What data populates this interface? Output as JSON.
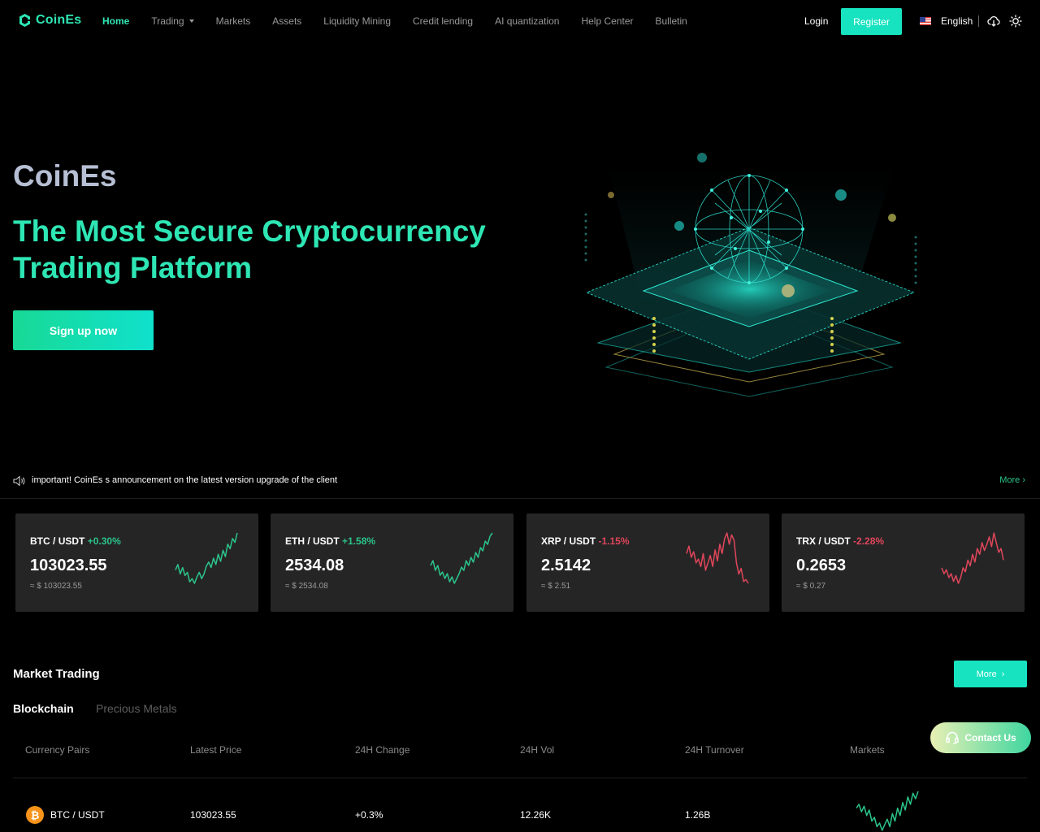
{
  "nav": {
    "brand": "CoinEs",
    "menu": [
      {
        "label": "Home",
        "active": true
      },
      {
        "label": "Trading",
        "dropdown": true
      },
      {
        "label": "Markets"
      },
      {
        "label": "Assets"
      },
      {
        "label": "Liquidity Mining"
      },
      {
        "label": "Credit lending"
      },
      {
        "label": "AI quantization"
      },
      {
        "label": "Help Center"
      },
      {
        "label": "Bulletin"
      }
    ],
    "login_label": "Login",
    "register_label": "Register",
    "language": "English",
    "icons": [
      "us-flag-icon",
      "download-cloud-icon",
      "sun-theme-icon"
    ]
  },
  "hero": {
    "brand": "CoinEs",
    "title": "The Most Secure Cryptocurrency Trading Platform",
    "cta_label": "Sign up now"
  },
  "announcement": {
    "text": "important! CoinEs s announcement on the latest version upgrade of the client",
    "more_label": "More"
  },
  "tickers": [
    {
      "base": "BTC",
      "quote": "USDT",
      "change": "+0.30%",
      "price": "103023.55",
      "usd": "≈ $ 103023.55",
      "trend": "up",
      "spark": [
        55,
        48,
        60,
        52,
        62,
        58,
        70,
        66,
        72,
        64,
        58,
        66,
        60,
        50,
        45,
        52,
        40,
        48,
        35,
        44,
        30,
        38,
        22,
        28,
        15,
        20,
        8
      ]
    },
    {
      "base": "ETH",
      "quote": "USDT",
      "change": "+1.58%",
      "price": "2534.08",
      "usd": "≈ $ 2534.08",
      "trend": "up",
      "spark": [
        50,
        44,
        56,
        50,
        62,
        58,
        66,
        60,
        70,
        64,
        72,
        66,
        60,
        52,
        56,
        44,
        50,
        40,
        46,
        34,
        40,
        28,
        32,
        20,
        24,
        14,
        10
      ]
    },
    {
      "base": "XRP",
      "quote": "USDT",
      "change": "-1.15%",
      "price": "2.5142",
      "usd": "≈ $ 2.51",
      "trend": "down",
      "spark": [
        30,
        22,
        34,
        28,
        40,
        36,
        44,
        30,
        48,
        40,
        32,
        44,
        26,
        38,
        20,
        30,
        14,
        8,
        20,
        10,
        16,
        40,
        52,
        46,
        60,
        58,
        62
      ]
    },
    {
      "base": "TRX",
      "quote": "USDT",
      "change": "-2.28%",
      "price": "0.2653",
      "usd": "≈ $ 0.27",
      "trend": "down",
      "spark": [
        44,
        50,
        46,
        54,
        50,
        58,
        52,
        60,
        54,
        44,
        48,
        36,
        42,
        30,
        38,
        24,
        30,
        18,
        26,
        20,
        12,
        22,
        8,
        18,
        28,
        24,
        36
      ]
    }
  ],
  "market": {
    "title": "Market Trading",
    "more_label": "More",
    "tabs": [
      {
        "label": "Blockchain",
        "active": true
      },
      {
        "label": "Precious Metals",
        "active": false
      }
    ],
    "columns": [
      "Currency Pairs",
      "Latest Price",
      "24H Change",
      "24H Vol",
      "24H Turnover",
      "Markets"
    ],
    "rows": [
      {
        "icon": "bitcoin-icon",
        "symbol": "₿",
        "pair": "BTC / USDT",
        "price": "103023.55",
        "change": "+0.3%",
        "vol": "12.26K",
        "turnover": "1.26B",
        "trend": "up",
        "spark": [
          24,
          20,
          28,
          22,
          32,
          26,
          38,
          34,
          44,
          40,
          48,
          42,
          36,
          44,
          30,
          38,
          24,
          32,
          18,
          26,
          12,
          20,
          8,
          14,
          6
        ]
      }
    ]
  },
  "contact": {
    "label": "Contact Us"
  },
  "colors": {
    "accent": "#2ee6b4",
    "up": "#2bc48a",
    "down": "#e0465a",
    "card_bg": "#252526",
    "button": "#17e3c0"
  }
}
